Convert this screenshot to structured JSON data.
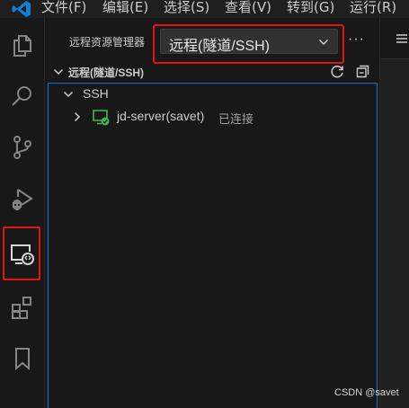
{
  "menu": {
    "items": [
      "文件(F)",
      "编辑(E)",
      "选择(S)",
      "查看(V)",
      "转到(G)",
      "运行(R)"
    ]
  },
  "activity_bar": {
    "items": [
      "files-icon",
      "search-icon",
      "source-control-icon",
      "run-debug-icon",
      "remote-explorer-icon",
      "extensions-icon",
      "bookmark-icon"
    ],
    "active": "remote-explorer-icon"
  },
  "sidebar": {
    "title": "远程资源管理器",
    "select_value": "远程(隧道/SSH)",
    "more": "···",
    "section_title": "远程(隧道/SSH)",
    "tree": {
      "group": "SSH",
      "server_name": "jd-server(savet)",
      "server_status": "已连接"
    }
  },
  "watermark": "CSDN @savet",
  "colors": {
    "highlight": "#e81010",
    "focus_border": "#0078d4",
    "connected": "#3fb950"
  }
}
